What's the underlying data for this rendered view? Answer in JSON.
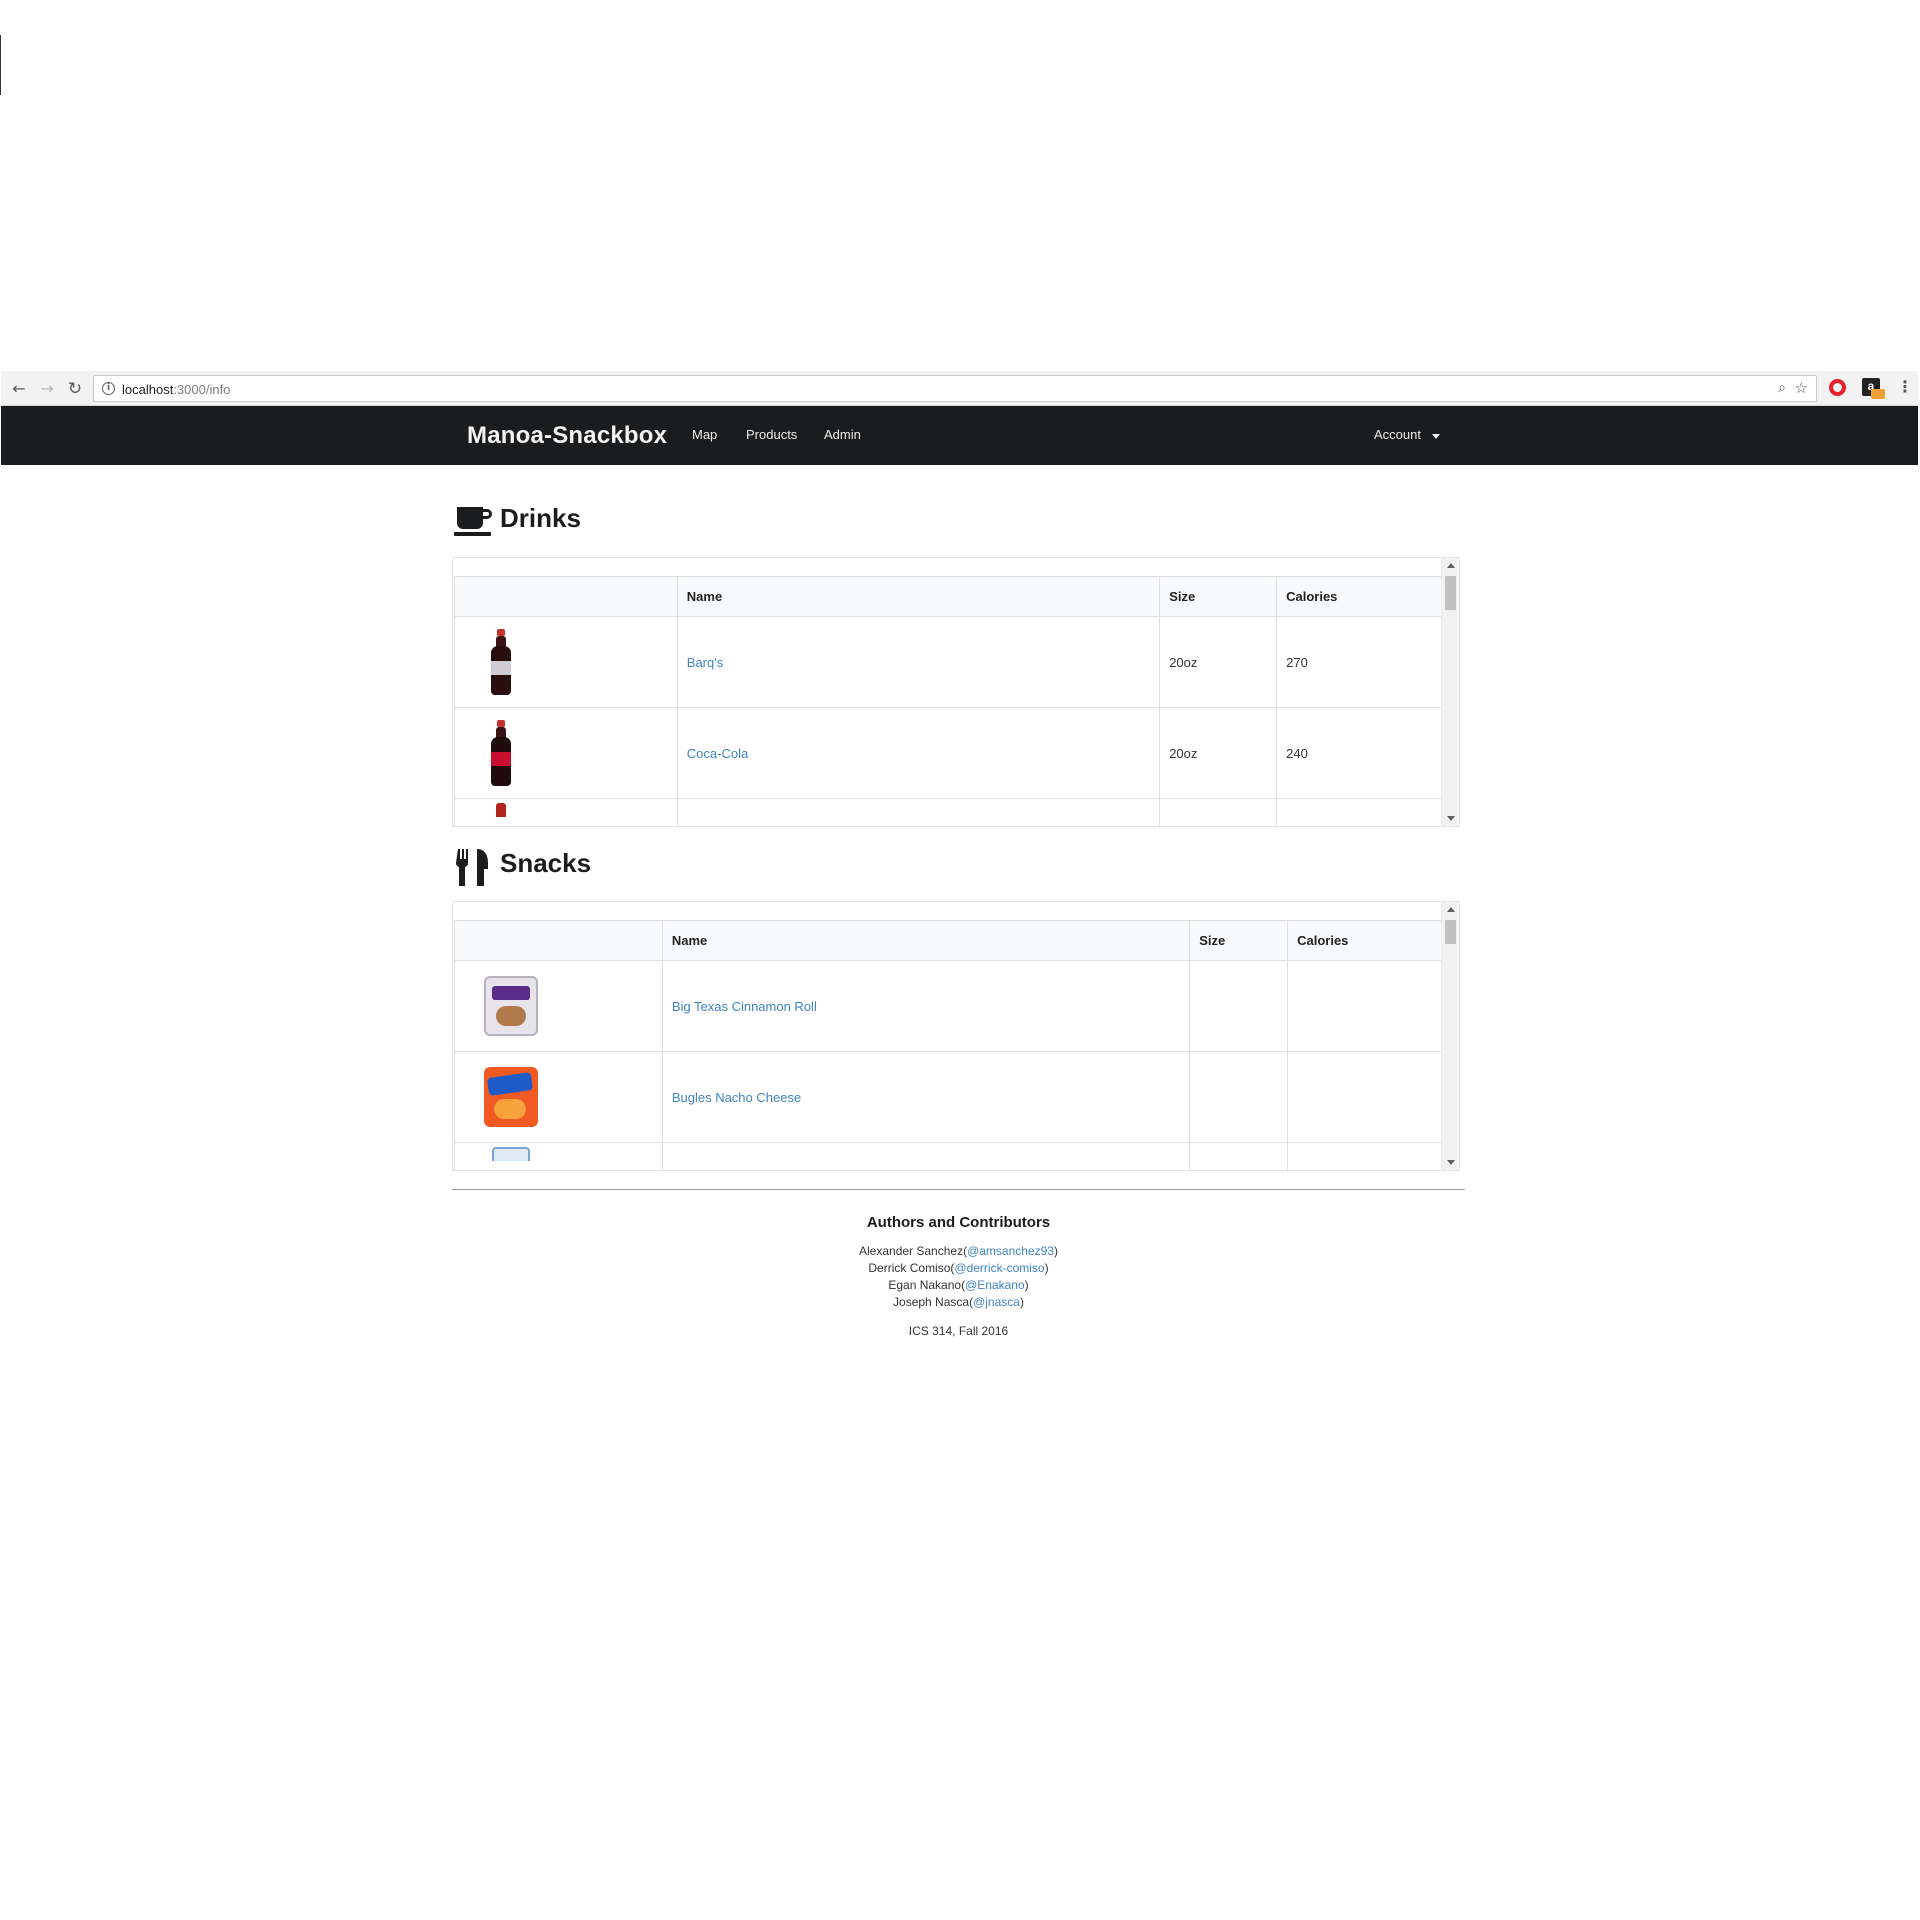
{
  "browser": {
    "url_host": "localhost",
    "url_path": ":3000/info",
    "ext_badge": "",
    "ext_letter": "a"
  },
  "navbar": {
    "brand": "Manoa-Snackbox",
    "links": [
      "Map",
      "Products",
      "Admin"
    ],
    "account": "Account"
  },
  "drinks": {
    "heading": "Drinks",
    "icon": "coffee-cup-icon",
    "columns": [
      "",
      "Name",
      "Size",
      "Calories"
    ],
    "rows": [
      {
        "image": "barqs-bottle",
        "name": "Barq's",
        "size": "20oz",
        "calories": "270"
      },
      {
        "image": "coca-cola-bottle",
        "name": "Coca-Cola",
        "size": "20oz",
        "calories": "240"
      }
    ]
  },
  "snacks": {
    "heading": "Snacks",
    "icon": "utensils-icon",
    "columns": [
      "",
      "Name",
      "Size",
      "Calories"
    ],
    "rows": [
      {
        "image": "big-texas-bag",
        "name": "Big Texas Cinnamon Roll",
        "size": "",
        "calories": ""
      },
      {
        "image": "bugles-bag",
        "name": "Bugles Nacho Cheese",
        "size": "",
        "calories": ""
      }
    ]
  },
  "footer": {
    "title": "Authors and Contributors",
    "authors": [
      {
        "name": "Alexander Sanchez",
        "handle": "@amsanchez93"
      },
      {
        "name": "Derrick Comiso",
        "handle": "@derrick-comiso"
      },
      {
        "name": "Egan Nakano",
        "handle": "@Enakano"
      },
      {
        "name": "Joseph Nasca",
        "handle": "@jnasca"
      }
    ],
    "course": "ICS 314, Fall 2016"
  },
  "colors": {
    "navbar_bg": "#1b1c1d",
    "link": "#4183c4",
    "table_header_bg": "#f9fafb"
  }
}
